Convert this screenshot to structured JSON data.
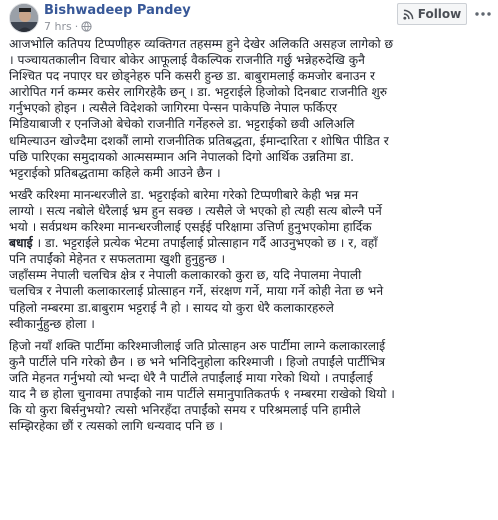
{
  "header": {
    "author": "Bishwadeep Pandey",
    "time": "7 hrs",
    "follow_label": "Follow"
  },
  "post": {
    "paragraphs": [
      {
        "lines": [
          "आजभोलि कतिपय टिप्पणीहरु व्यक्तिगत तहसम्म हुने देखेर अलिकति असहज लागेको छ",
          "। पञ्चायतकालीन विचार बोकेर आफूलाई वैकल्पिक राजनीति गर्छु भन्नेहरुदेखि कुनै",
          "निश्चित पद नपाएर घर छोड्नेहरु पनि कसरी हुन्छ डा. बाबुरामलाई कमजोर बनाउन र",
          "आरोपित गर्न कम्मर कसेर लागिरहेकै छन् । डा. भट्टराईले हिजोको दिनबाट राजनीति शुरु",
          "गर्नुभएको होइन । त्यसैले विदेशको जागिरमा पेन्सन पाकेपछि नेपाल फर्किएर",
          "मिडियाबाजी र एनजिओ बेचेको राजनीति गर्नेहरुले डा. भट्टराईको छवी अलिअलि",
          "धमिल्याउन खोज्दैमा दशकौं लामो राजनीतिक प्रतिबद्धता, ईमान्दारिता र शोषित पीडित र",
          "पछि पारिएका समुदायको आत्मसम्मान अनि नेपालको दिगो आर्थिक उन्नतिमा डा.",
          "भट्टराईको प्रतिबद्धतामा कहिले कमी आउने छैन ।"
        ]
      },
      {
        "lines": [
          "भर्खरै करिश्मा मानन्धरजीले डा. भट्टराईको बारेमा गरेको टिप्पणीबारे केही भन्न मन",
          "लाग्यो । सत्य नबोले धेरैलाई भ्रम हुन सक्छ । त्यसैले जे भएको हो त्यही सत्य बोल्नै पर्ने",
          "भयो । सर्वप्रथम करिश्मा मानन्धरजीलाई एसईई परिक्षामा उत्तिर्ण हुनुभएकोमा हार्दिक"
        ],
        "emph_word": "बधाई",
        "lines_after": [
          "। डा. भट्टराईले प्रत्येक भेटमा तपाईंलाई प्रोत्साहान गर्दै आउनुभएको छ । र, वहाँ",
          "पनि तपाईंको मेहेनत र सफलतामा खुशी हुनुहुन्छ ।",
          "जहाँसम्म नेपाली चलचित्र क्षेत्र र नेपाली कलाकारको कुरा छ, यदि नेपालमा नेपाली",
          "चलचित्र र नेपाली कलाकारलाई प्रोत्साहन गर्ने, संरक्षण गर्ने, माया गर्ने कोही नेता छ भने",
          "पहिलो नम्बरमा डा.बाबुराम भट्टराई नै हो । सायद यो कुरा धेरै कलाकारहरुले",
          "स्वीकार्नुहुन्छ होला ।"
        ]
      },
      {
        "lines": [
          "हिजो नयाँ शक्ति पार्टीमा करिश्माजीलाई जति प्रोत्साहन अरु पार्टीमा लाग्ने कलाकारलाई",
          "कुनै पार्टीले पनि गरेको छैन । छ भने भनिदिनुहोला करिश्माजी । हिजो तपाईंले पार्टीभित्र",
          "जति मेहनत गर्नुभयो त्यो भन्दा धेरै नै पार्टीले तपाईंलाई माया गरेको थियो । तपाईंलाई",
          "याद नै छ होला चुनावमा तपाईंको नाम पार्टीले समानुपातिकतर्फ १ नम्बरमा राखेको थियो ।",
          "कि यो कुरा बिर्सनुभयो? त्यसो भनिरहँदा तपाईंको समय र परिश्रमलाई पनि हामीले",
          "सम्झिरहेका छौं र त्यसको लागि धन्यवाद पनि छ ।"
        ]
      }
    ]
  }
}
